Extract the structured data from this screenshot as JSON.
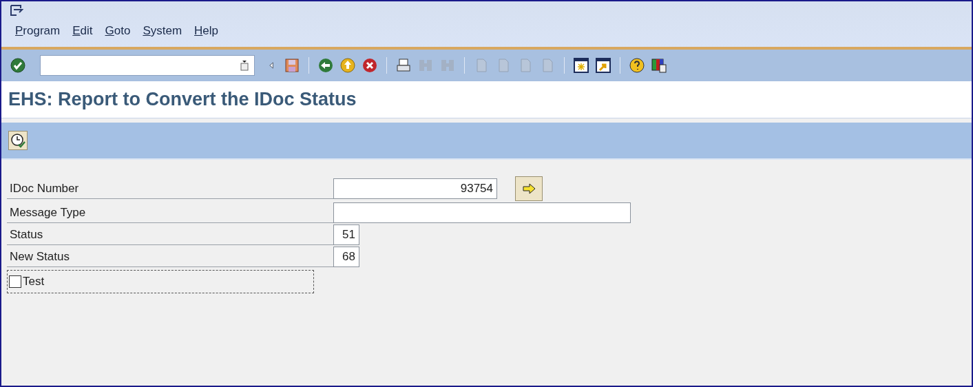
{
  "menu": [
    {
      "label": "Program"
    },
    {
      "label": "Edit"
    },
    {
      "label": "Goto"
    },
    {
      "label": "System"
    },
    {
      "label": "Help"
    }
  ],
  "toolbar": [
    {
      "kind": "enter",
      "disabled": false
    },
    {
      "kind": "command"
    },
    {
      "kind": "prev",
      "disabled": false
    },
    {
      "kind": "save",
      "disabled": false
    },
    {
      "kind": "sep"
    },
    {
      "kind": "back",
      "disabled": false
    },
    {
      "kind": "exit",
      "disabled": false
    },
    {
      "kind": "cancel",
      "disabled": false
    },
    {
      "kind": "sep"
    },
    {
      "kind": "print",
      "disabled": false
    },
    {
      "kind": "find",
      "disabled": true
    },
    {
      "kind": "findnext",
      "disabled": true
    },
    {
      "kind": "sep"
    },
    {
      "kind": "page",
      "disabled": true
    },
    {
      "kind": "page",
      "disabled": true
    },
    {
      "kind": "page",
      "disabled": true
    },
    {
      "kind": "page",
      "disabled": true
    },
    {
      "kind": "sep"
    },
    {
      "kind": "session",
      "disabled": false
    },
    {
      "kind": "shortcut",
      "disabled": false
    },
    {
      "kind": "sep"
    },
    {
      "kind": "help",
      "disabled": false
    },
    {
      "kind": "layout",
      "disabled": false
    }
  ],
  "title": "EHS: Report to Convert the IDoc Status",
  "fields": [
    {
      "label": "IDoc Number",
      "value": "93754",
      "kind": "number"
    },
    {
      "label": "Message Type",
      "kind": "wide"
    },
    {
      "label": "Status",
      "value": "51",
      "kind": "short"
    },
    {
      "label": "New Status",
      "value": "68",
      "kind": "short"
    }
  ],
  "test": {
    "label": "Test",
    "checked": false
  }
}
